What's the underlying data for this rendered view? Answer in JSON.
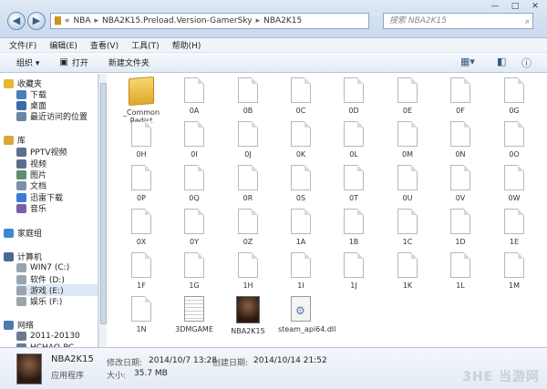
{
  "address": {
    "segments": [
      "«",
      "NBA",
      "NBA2K15.Preload.Version-GamerSky",
      "NBA2K15"
    ]
  },
  "search": {
    "placeholder": "搜索 NBA2K15"
  },
  "window_controls": [
    "—",
    "□",
    "✕"
  ],
  "menu": [
    "文件(F)",
    "编辑(E)",
    "查看(V)",
    "工具(T)",
    "帮助(H)"
  ],
  "toolbar": {
    "organize": "组织 ▾",
    "open": "打开",
    "new_folder": "新建文件夹"
  },
  "nav": [
    {
      "label": "收藏夹",
      "group": true,
      "icon": "star-icon"
    },
    {
      "label": "下载",
      "icon": "download-folder-icon"
    },
    {
      "label": "桌面",
      "icon": "desktop-icon"
    },
    {
      "label": "最近访问的位置",
      "icon": "recent-places-icon"
    },
    {
      "label": "库",
      "group": true,
      "icon": "library-icon"
    },
    {
      "label": "PPTV视频",
      "icon": "video-library-icon"
    },
    {
      "label": "视频",
      "icon": "video-library-icon"
    },
    {
      "label": "图片",
      "icon": "picture-library-icon"
    },
    {
      "label": "文档",
      "icon": "document-library-icon"
    },
    {
      "label": "迅雷下载",
      "icon": "thunder-download-icon"
    },
    {
      "label": "音乐",
      "icon": "music-library-icon"
    },
    {
      "label": "家庭组",
      "group": true,
      "icon": "homegroup-icon"
    },
    {
      "label": "计算机",
      "group": true,
      "icon": "computer-icon"
    },
    {
      "label": "WIN7 (C:)",
      "icon": "drive-icon"
    },
    {
      "label": "软件 (D:)",
      "icon": "drive-icon"
    },
    {
      "label": "游戏 (E:)",
      "icon": "drive-icon",
      "selected": true
    },
    {
      "label": "娱乐 (F:)",
      "icon": "drive-icon"
    },
    {
      "label": "网络",
      "group": true,
      "icon": "network-icon"
    },
    {
      "label": "2011-20130",
      "icon": "network-pc-icon"
    },
    {
      "label": "HCHAO-PC",
      "icon": "network-pc-icon"
    }
  ],
  "files": [
    {
      "name": "_Common Redist",
      "type": "folder"
    },
    {
      "name": "0A",
      "type": "file"
    },
    {
      "name": "0B",
      "type": "file"
    },
    {
      "name": "0C",
      "type": "file"
    },
    {
      "name": "0D",
      "type": "file"
    },
    {
      "name": "0E",
      "type": "file"
    },
    {
      "name": "0F",
      "type": "file"
    },
    {
      "name": "0G",
      "type": "file"
    },
    {
      "name": "0H",
      "type": "file"
    },
    {
      "name": "0I",
      "type": "file"
    },
    {
      "name": "0J",
      "type": "file"
    },
    {
      "name": "0K",
      "type": "file"
    },
    {
      "name": "0L",
      "type": "file"
    },
    {
      "name": "0M",
      "type": "file"
    },
    {
      "name": "0N",
      "type": "file"
    },
    {
      "name": "0O",
      "type": "file"
    },
    {
      "name": "0P",
      "type": "file"
    },
    {
      "name": "0Q",
      "type": "file"
    },
    {
      "name": "0R",
      "type": "file"
    },
    {
      "name": "0S",
      "type": "file"
    },
    {
      "name": "0T",
      "type": "file"
    },
    {
      "name": "0U",
      "type": "file"
    },
    {
      "name": "0V",
      "type": "file"
    },
    {
      "name": "0W",
      "type": "file"
    },
    {
      "name": "0X",
      "type": "file"
    },
    {
      "name": "0Y",
      "type": "file"
    },
    {
      "name": "0Z",
      "type": "file"
    },
    {
      "name": "1A",
      "type": "file"
    },
    {
      "name": "1B",
      "type": "file"
    },
    {
      "name": "1C",
      "type": "file"
    },
    {
      "name": "1D",
      "type": "file"
    },
    {
      "name": "1E",
      "type": "file"
    },
    {
      "name": "1F",
      "type": "file"
    },
    {
      "name": "1G",
      "type": "file"
    },
    {
      "name": "1H",
      "type": "file"
    },
    {
      "name": "1I",
      "type": "file"
    },
    {
      "name": "1J",
      "type": "file"
    },
    {
      "name": "1K",
      "type": "file"
    },
    {
      "name": "1L",
      "type": "file"
    },
    {
      "name": "1M",
      "type": "file"
    },
    {
      "name": "1N",
      "type": "file"
    },
    {
      "name": "3DMGAME",
      "type": "exe"
    },
    {
      "name": "NBA2K15",
      "type": "app"
    },
    {
      "name": "steam_api64.dll",
      "type": "dll"
    }
  ],
  "status": {
    "name": "NBA2K15",
    "type": "应用程序",
    "modified_label": "修改日期:",
    "modified": "2014/10/7 13:28",
    "created_label": "创建日期:",
    "created": "2014/10/14 21:52",
    "size_label": "大小:",
    "size": "35.7 MB"
  },
  "watermark": "3HE 当游网"
}
